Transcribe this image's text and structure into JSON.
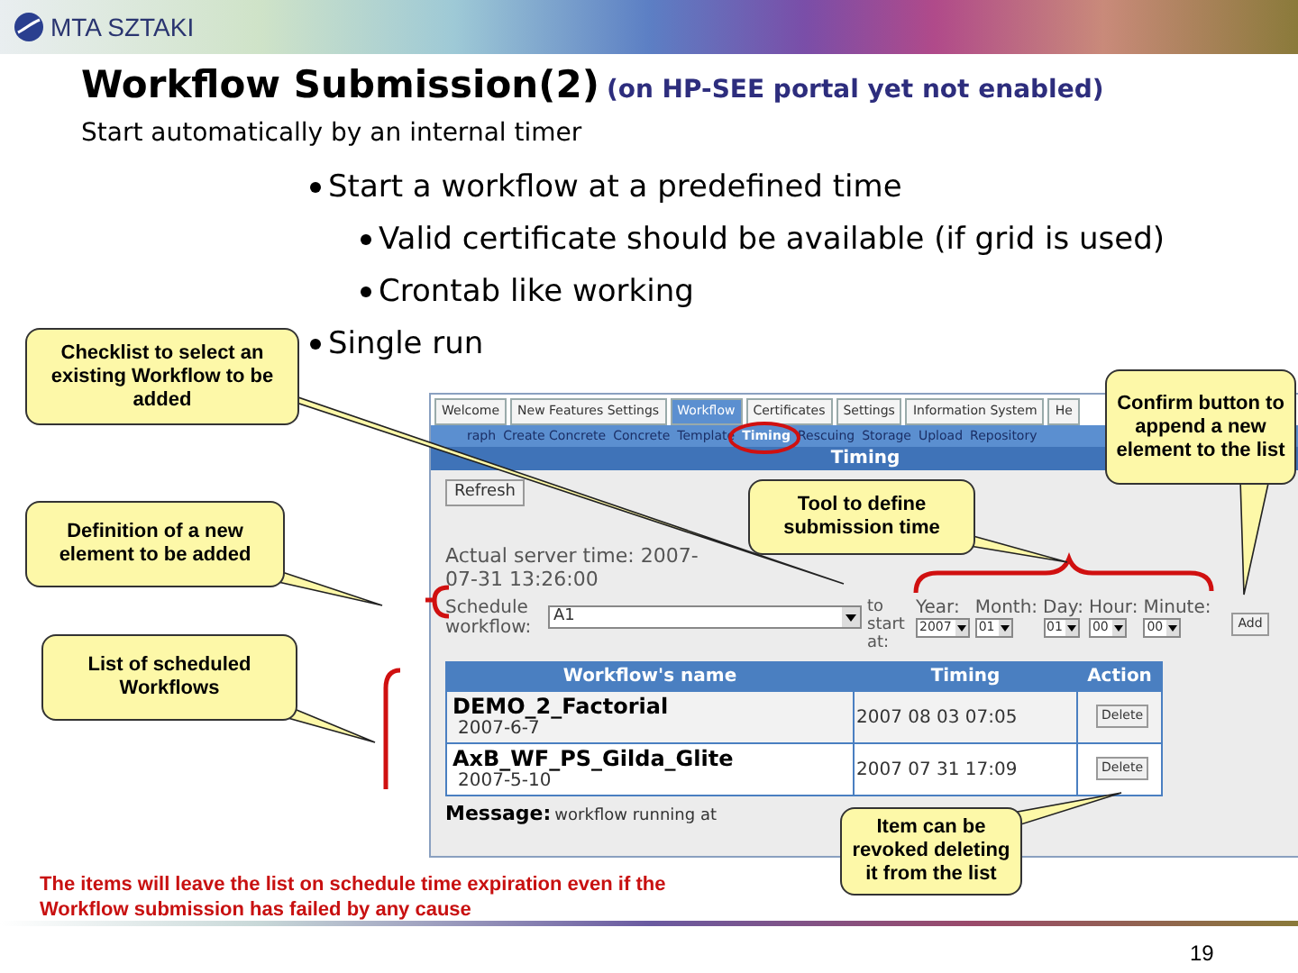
{
  "header": {
    "logo_text": "MTA SZTAKI"
  },
  "title": "Workflow Submission(2)",
  "title_note": "(on HP-SEE portal yet not enabled)",
  "subtitle": "Start automatically by an internal timer",
  "bullets": [
    {
      "text": "Start a workflow at a predefined time",
      "children": [
        {
          "text": "Valid certificate should be available (if grid is used)"
        },
        {
          "text": "Crontab like working"
        }
      ]
    },
    {
      "text": "Single run"
    }
  ],
  "screenshot": {
    "tabs": [
      {
        "label": "Welcome",
        "selected": false
      },
      {
        "label": "New Features Settings",
        "selected": false
      },
      {
        "label": "Workflow",
        "selected": true
      },
      {
        "label": "Certificates",
        "selected": false
      },
      {
        "label": "Settings",
        "selected": false
      },
      {
        "label": "Information System",
        "selected": false
      },
      {
        "label": "He",
        "selected": false
      }
    ],
    "subtabs": [
      {
        "label": "raph",
        "selected": false
      },
      {
        "label": "Create Concrete",
        "selected": false
      },
      {
        "label": "Concrete",
        "selected": false
      },
      {
        "label": "Template",
        "selected": false
      },
      {
        "label": "Timing",
        "selected": true
      },
      {
        "label": "Rescuing",
        "selected": false
      },
      {
        "label": "Storage",
        "selected": false
      },
      {
        "label": "Upload",
        "selected": false
      },
      {
        "label": "Repository",
        "selected": false
      }
    ],
    "panel_title": "Timing",
    "refresh_button": "Refresh",
    "server_time_label": "Actual server time: 2007-",
    "server_time": "07-31 13:26:00",
    "schedule_label": "Schedule workflow:",
    "workflow_select": "A1",
    "start_label": "to start at:",
    "date_fields": [
      {
        "label": "Year:",
        "value": "2007"
      },
      {
        "label": "Month:",
        "value": "01"
      },
      {
        "label": "Day:",
        "value": "01"
      },
      {
        "label": "Hour:",
        "value": "00"
      },
      {
        "label": "Minute:",
        "value": "00"
      }
    ],
    "add_button": "Add",
    "table": {
      "columns": [
        "Workflow's name",
        "Timing",
        "Action"
      ],
      "rows": [
        {
          "name": "DEMO_2_Factorial",
          "date": "2007-6-7",
          "timing": "2007 08 03 07:05",
          "action": "Delete"
        },
        {
          "name": "AxB_WF_PS_Gilda_Glite",
          "date": "2007-5-10",
          "timing": "2007 07 31 17:09",
          "action": "Delete"
        }
      ]
    },
    "message_label": "Message:",
    "message": "workflow running at"
  },
  "callouts": [
    {
      "text": "Checklist to select an existing Workflow to be added"
    },
    {
      "text": "Definition of a new element to be added"
    },
    {
      "text": "List of scheduled Workflows"
    },
    {
      "text": "Tool to define submission time"
    },
    {
      "text": "Confirm button to append a new element to the list"
    },
    {
      "text": "Item can be revoked deleting it from the list"
    }
  ],
  "note": "The items will leave the list on schedule time expiration even if the  Workflow submission has failed by any cause",
  "page_number": "19"
}
